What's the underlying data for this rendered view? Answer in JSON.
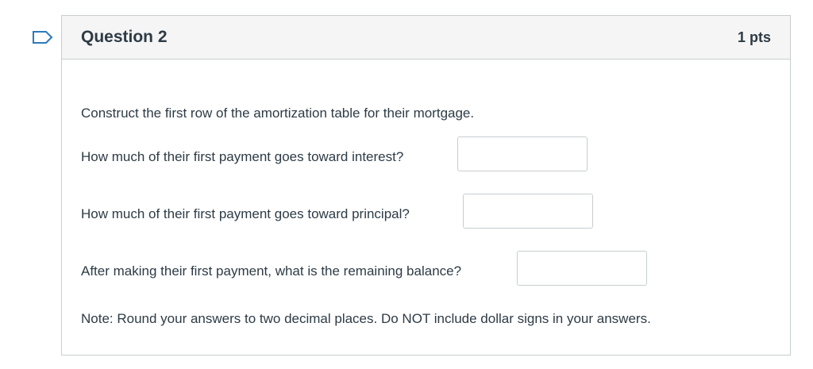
{
  "flag": {
    "icon": "flag-outline-icon",
    "color": "#2b7abc"
  },
  "question": {
    "title": "Question 2",
    "points": "1 pts",
    "intro": "Construct the first row of the amortization table for their mortgage.",
    "prompts": [
      {
        "label": "How much of their first payment goes toward interest?",
        "value": ""
      },
      {
        "label": "How much of their first payment goes toward principal?",
        "value": ""
      },
      {
        "label": "After making their first payment, what is the remaining balance?",
        "value": ""
      }
    ],
    "note": "Note: Round your answers to two decimal places. Do NOT include dollar signs in your answers."
  }
}
